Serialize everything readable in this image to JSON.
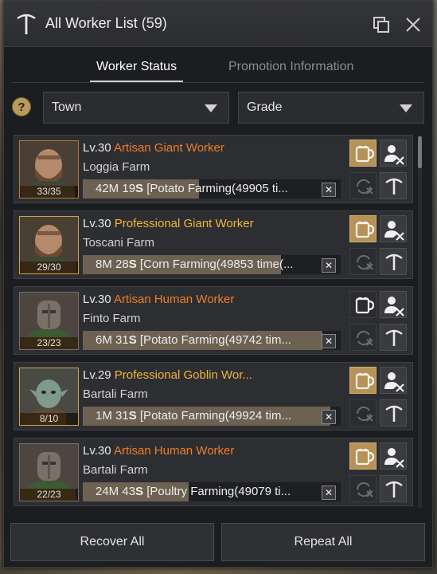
{
  "window": {
    "title": "All Worker List",
    "count": "(59)"
  },
  "tabs": [
    {
      "label": "Worker Status",
      "active": true
    },
    {
      "label": "Promotion Information",
      "active": false
    }
  ],
  "filters": {
    "help": "?",
    "town": "Town",
    "grade": "Grade"
  },
  "workers": [
    {
      "level_prefix": "Lv.",
      "level": "30",
      "grade": "Artisan Giant Worker",
      "grade_tier": "artisan",
      "farm": "Loggia Farm",
      "stamina": "33/35",
      "stamina_fraction": 0.94,
      "job_time": "42M 19",
      "job_time_suffix": "S",
      "job": "[Potato Farming(49905 ti...",
      "job_progress": 0.45,
      "feed_active": true,
      "portrait": "giant"
    },
    {
      "level_prefix": "Lv.",
      "level": "30",
      "grade": "Professional Giant Worker",
      "grade_tier": "professional",
      "farm": "Toscani Farm",
      "stamina": "29/30",
      "stamina_fraction": 0.97,
      "job_time": "8M 28",
      "job_time_suffix": "S",
      "job": "[Corn Farming(49853 time(...",
      "job_progress": 0.77,
      "feed_active": true,
      "portrait": "giant"
    },
    {
      "level_prefix": "Lv.",
      "level": "30",
      "grade": "Artisan Human Worker",
      "grade_tier": "artisan",
      "farm": "Finto Farm",
      "stamina": "23/23",
      "stamina_fraction": 1.0,
      "job_time": "6M 31",
      "job_time_suffix": "S",
      "job": "[Potato Farming(49742 tim...",
      "job_progress": 0.93,
      "feed_active": false,
      "portrait": "human"
    },
    {
      "level_prefix": "Lv.",
      "level": "29",
      "grade": "Professional Goblin Wor...",
      "grade_tier": "professional",
      "farm": "Bartali Farm",
      "stamina": "8/10",
      "stamina_fraction": 0.8,
      "job_time": "1M 31",
      "job_time_suffix": "S",
      "job": "[Potato Farming(49924 tim...",
      "job_progress": 0.96,
      "feed_active": true,
      "portrait": "goblin"
    },
    {
      "level_prefix": "Lv.",
      "level": "30",
      "grade": "Artisan Human Worker",
      "grade_tier": "artisan",
      "farm": "Bartali Farm",
      "stamina": "22/23",
      "stamina_fraction": 0.96,
      "job_time": "24M 43",
      "job_time_suffix": "S",
      "job": "[Poultry Farming(49079 ti...",
      "job_progress": 0.41,
      "feed_active": true,
      "portrait": "human"
    }
  ],
  "footer": {
    "recover_all": "Recover All",
    "repeat_all": "Repeat All"
  },
  "colors": {
    "artisan": "#ee7d2a",
    "professional": "#f2b535",
    "gold_button": "#b59258",
    "window_bg": "#1c1d20"
  }
}
